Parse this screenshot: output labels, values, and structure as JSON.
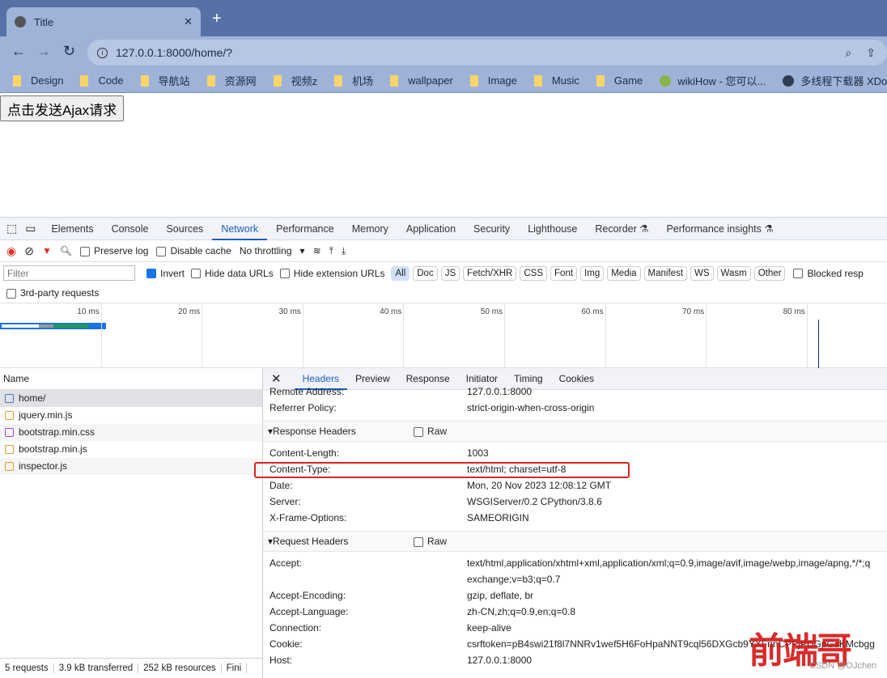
{
  "browser": {
    "tab_title": "Title",
    "url": "127.0.0.1:8000/home/?",
    "bookmarks": [
      {
        "label": "Design",
        "icon": "folder"
      },
      {
        "label": "Code",
        "icon": "folder"
      },
      {
        "label": "导航站",
        "icon": "folder"
      },
      {
        "label": "资源网",
        "icon": "folder"
      },
      {
        "label": "视频z",
        "icon": "folder"
      },
      {
        "label": "机场",
        "icon": "folder"
      },
      {
        "label": "wallpaper",
        "icon": "folder"
      },
      {
        "label": "Image",
        "icon": "folder"
      },
      {
        "label": "Music",
        "icon": "folder"
      },
      {
        "label": "Game",
        "icon": "folder"
      },
      {
        "label": "wikiHow - 您可以...",
        "icon": "wikihow"
      },
      {
        "label": "多线程下载器 XDo...",
        "icon": "xdown"
      }
    ]
  },
  "page": {
    "ajax_button": "点击发送Ajax请求"
  },
  "devtools": {
    "tabs": [
      "Elements",
      "Console",
      "Sources",
      "Network",
      "Performance",
      "Memory",
      "Application",
      "Security",
      "Lighthouse",
      "Recorder ⚗",
      "Performance insights ⚗"
    ],
    "active_tab": "Network",
    "toolbar": {
      "preserve_log": "Preserve log",
      "disable_cache": "Disable cache",
      "throttling": "No throttling"
    },
    "filter": {
      "placeholder": "Filter",
      "invert": "Invert",
      "hide_data_urls": "Hide data URLs",
      "hide_ext_urls": "Hide extension URLs",
      "chips": [
        "All",
        "Doc",
        "JS",
        "Fetch/XHR",
        "CSS",
        "Font",
        "Img",
        "Media",
        "Manifest",
        "WS",
        "Wasm",
        "Other"
      ],
      "blocked": "Blocked resp",
      "third_party": "3rd-party requests"
    },
    "timeline_ticks": [
      "10 ms",
      "20 ms",
      "30 ms",
      "40 ms",
      "50 ms",
      "60 ms",
      "70 ms",
      "80 ms"
    ],
    "name_header": "Name",
    "requests": [
      "home/",
      "jquery.min.js",
      "bootstrap.min.css",
      "bootstrap.min.js",
      "inspector.js"
    ],
    "status": [
      "5 requests",
      "3.9 kB transferred",
      "252 kB resources",
      "Fini"
    ],
    "detail_tabs": [
      "Headers",
      "Preview",
      "Response",
      "Initiator",
      "Timing",
      "Cookies"
    ],
    "general_rows": [
      {
        "k": "Remote Address:",
        "v": "127.0.0.1:8000"
      },
      {
        "k": "Referrer Policy:",
        "v": "strict-origin-when-cross-origin"
      }
    ],
    "response_title": "Response Headers",
    "raw": "Raw",
    "response_rows": [
      {
        "k": "Content-Length:",
        "v": "1003"
      },
      {
        "k": "Content-Type:",
        "v": "text/html; charset=utf-8"
      },
      {
        "k": "Date:",
        "v": "Mon, 20 Nov 2023 12:08:12 GMT"
      },
      {
        "k": "Server:",
        "v": "WSGIServer/0.2 CPython/3.8.6"
      },
      {
        "k": "X-Frame-Options:",
        "v": "SAMEORIGIN"
      }
    ],
    "request_title": "Request Headers",
    "request_rows": [
      {
        "k": "Accept:",
        "v": "text/html,application/xhtml+xml,application/xml;q=0.9,image/avif,image/webp,image/apng,*/*;q"
      },
      {
        "k": "",
        "v": "exchange;v=b3;q=0.7"
      },
      {
        "k": "Accept-Encoding:",
        "v": "gzip, deflate, br"
      },
      {
        "k": "Accept-Language:",
        "v": "zh-CN,zh;q=0.9,en;q=0.8"
      },
      {
        "k": "Connection:",
        "v": "keep-alive"
      },
      {
        "k": "Cookie:",
        "v": "csrftoken=pB4swi21f8l7NNRv1wef5H6FoHpaNNT9cql56DXGcb9YXFnnCPPjPDGpGsKMcbgg"
      },
      {
        "k": "Host:",
        "v": "127.0.0.1:8000"
      }
    ]
  },
  "watermark": "前端哥",
  "credit": "CSDN @OJchen",
  "colors": {
    "accent": "#1a5fc7",
    "highlight": "#e02020"
  }
}
